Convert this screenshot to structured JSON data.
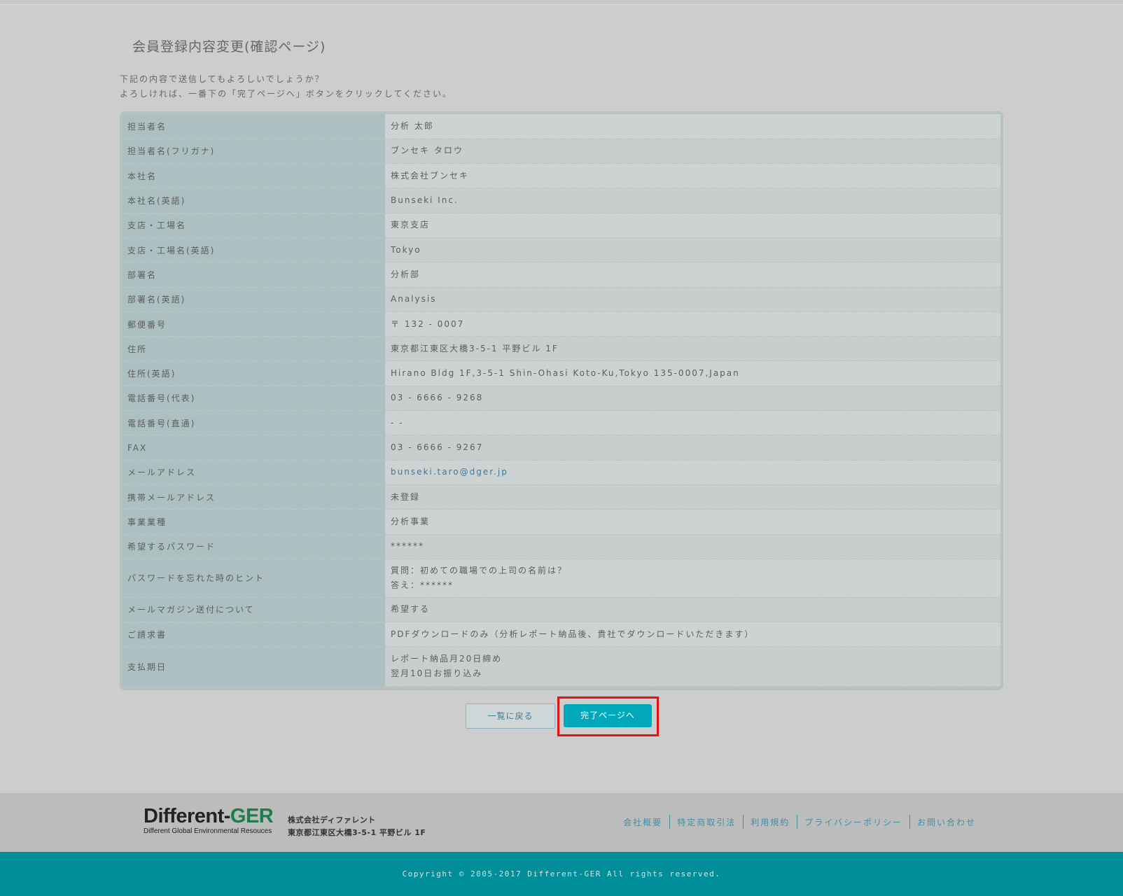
{
  "page": {
    "title": "会員登録内容変更(確認ページ)",
    "intro_line1": "下記の内容で送信してもよろしいでしょうか？",
    "intro_line2": "よろしければ、一番下の「完了ページへ」ボタンをクリックしてください。"
  },
  "rows": [
    {
      "label": "担当者名",
      "value": "分析 太郎"
    },
    {
      "label": "担当者名(フリガナ)",
      "value": "ブンセキ タロウ"
    },
    {
      "label": "本社名",
      "value": "株式会社ブンセキ"
    },
    {
      "label": "本社名(英語)",
      "value": "Bunseki Inc."
    },
    {
      "label": "支店・工場名",
      "value": "東京支店"
    },
    {
      "label": "支店・工場名(英語)",
      "value": "Tokyo"
    },
    {
      "label": "部署名",
      "value": "分析部"
    },
    {
      "label": "部署名(英語)",
      "value": "Analysis"
    },
    {
      "label": "郵便番号",
      "value": "〒 132 - 0007"
    },
    {
      "label": "住所",
      "value": "東京都江東区大橋3-5-1 平野ビル 1F"
    },
    {
      "label": "住所(英語)",
      "value": "Hirano Bldg 1F,3-5-1 Shin-Ohasi Koto-Ku,Tokyo 135-0007,Japan"
    },
    {
      "label": "電話番号(代表)",
      "value": "03 - 6666 - 9268"
    },
    {
      "label": "電話番号(直通)",
      "value": "- -"
    },
    {
      "label": "FAX",
      "value": "03 - 6666 - 9267"
    },
    {
      "label": "メールアドレス",
      "value": "bunseki.taro@dger.jp",
      "link": true
    },
    {
      "label": "携帯メールアドレス",
      "value": "未登録"
    },
    {
      "label": "事業業種",
      "value": "分析事業"
    },
    {
      "label": "希望するパスワード",
      "value": "******"
    },
    {
      "label": "パスワードを忘れた時のヒント",
      "value": "質問：初めての職場での上司の名前は？",
      "value2": "答え：******"
    },
    {
      "label": "メールマガジン送付について",
      "value": "希望する"
    },
    {
      "label": "ご請求書",
      "value": "PDFダウンロードのみ（分析レポート納品後、貴社でダウンロードいただきます）"
    },
    {
      "label": "支払期日",
      "value": "レポート納品月20日締め",
      "value2": "翌月10日お振り込み"
    }
  ],
  "buttons": {
    "back": "一覧に戻る",
    "done": "完了ページへ"
  },
  "footer": {
    "logo_main_1": "Different-",
    "logo_main_2": "GER",
    "logo_sub": "Different Global Environmental Resouces",
    "company_name": "株式会社ディファレント",
    "company_address": "東京都江東区大橋3-5-1 平野ビル 1F",
    "nav": [
      "会社概要",
      "特定商取引法",
      "利用規約",
      "プライバシーポリシー",
      "お問い合わせ"
    ],
    "copyright": "Copyright © 2005-2017 Different-GER All rights reserved."
  }
}
